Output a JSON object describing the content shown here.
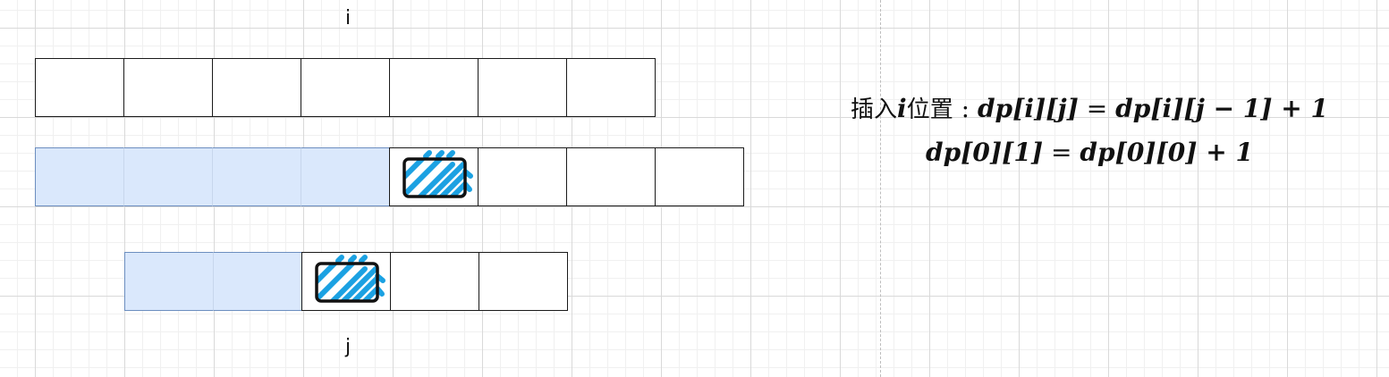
{
  "labels": {
    "i": "i",
    "j": "j"
  },
  "formulas": {
    "line1": {
      "prefix_cjk_1": "插入",
      "prefix_var": "i",
      "prefix_cjk_2": "位置",
      "colon": ":",
      "lhs": "dp[i][j]",
      "equals": "=",
      "rhs": "dp[i][j − 1] + 1"
    },
    "line2": {
      "lhs": "dp[0][1]",
      "equals": "=",
      "rhs": "dp[0][0] + 1"
    }
  },
  "arrays": [
    {
      "name": "top-array",
      "cells": 7,
      "filled_cells": 0,
      "highlight_index": null
    },
    {
      "name": "middle-array",
      "cells": 8,
      "filled_cells": 4,
      "highlight_index": 4
    },
    {
      "name": "bottom-array",
      "cells": 5,
      "filled_cells": 2,
      "highlight_index": 2
    }
  ],
  "colors": {
    "filled_cell": "#dae8fc",
    "hatch": "#1ba1e2",
    "outline": "#111111",
    "grid_major": "#d9d9d9",
    "grid_minor": "#f0f0f0"
  }
}
